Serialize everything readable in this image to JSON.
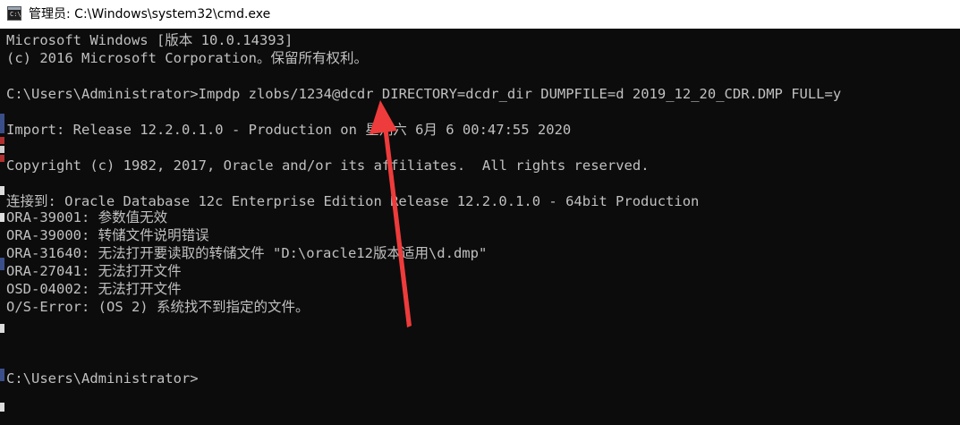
{
  "window": {
    "title": "管理员: C:\\Windows\\system32\\cmd.exe",
    "icon": "cmd-icon"
  },
  "console": {
    "lines": [
      "Microsoft Windows [版本 10.0.14393]",
      "(c) 2016 Microsoft Corporation。保留所有权利。",
      "",
      "C:\\Users\\Administrator>Impdp zlobs/1234@dcdr DIRECTORY=dcdr_dir DUMPFILE=d 2019_12_20_CDR.DMP FULL=y",
      "",
      "Import: Release 12.2.0.1.0 - Production on 星期六 6月 6 00:47:55 2020",
      "",
      "Copyright (c) 1982, 2017, Oracle and/or its affiliates.  All rights reserved.",
      "",
      "连接到: Oracle Database 12c Enterprise Edition Release 12.2.0.1.0 - 64bit Production",
      "ORA-39001: 参数值无效",
      "ORA-39000: 转储文件说明错误",
      "ORA-31640: 无法打开要读取的转储文件 \"D:\\oracle12版本适用\\d.dmp\"",
      "ORA-27041: 无法打开文件",
      "OSD-04002: 无法打开文件",
      "O/S-Error: (OS 2) 系统找不到指定的文件。",
      "",
      "",
      "",
      "C:\\Users\\Administrator>"
    ]
  },
  "colors": {
    "console_bg": "#0c0c0c",
    "console_text": "#c0c0c0",
    "annotation_arrow": "#ee3b3b"
  }
}
